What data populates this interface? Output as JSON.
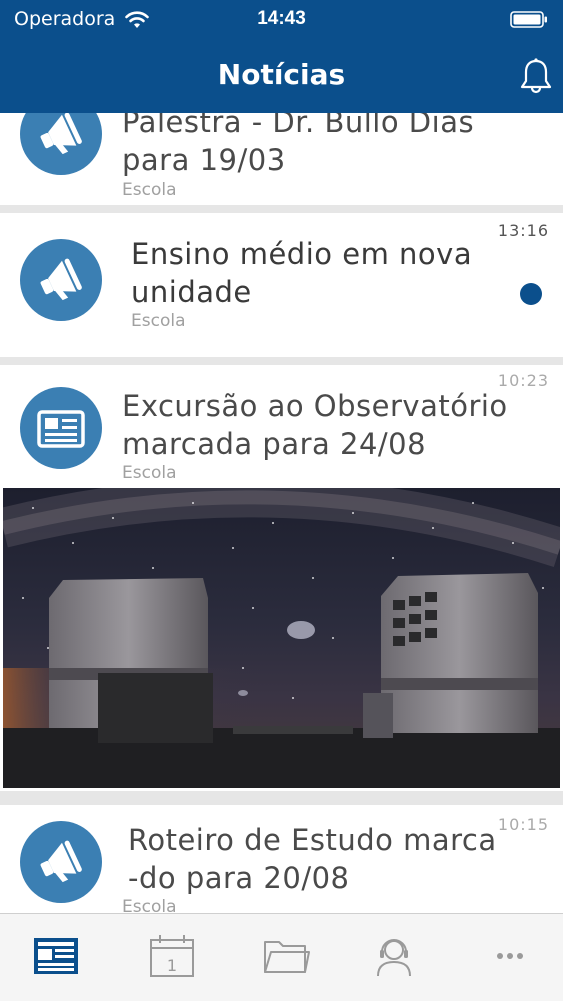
{
  "status_bar": {
    "carrier": "Operadora",
    "time": "14:43"
  },
  "header": {
    "title": "Notícias"
  },
  "news": [
    {
      "title_line1": "Palestra - Dr. Bullo Dias",
      "title_line2": "para 19/03",
      "source": "Escola",
      "time": "",
      "icon": "megaphone-icon"
    },
    {
      "title_line1": "Ensino médio em nova",
      "title_line2": "unidade",
      "source": "Escola",
      "time": "13:16",
      "unread": true,
      "icon": "megaphone-icon"
    },
    {
      "title_line1": "Excursão ao Observatório",
      "title_line2": "marcada para 24/08",
      "source": "Escola",
      "time": "10:23",
      "icon": "newspaper-icon",
      "has_photo": true
    },
    {
      "title_line1": "Roteiro de Estudo marca",
      "title_line2": "-do para 20/08",
      "source": "Escola",
      "time": "10:15",
      "icon": "megaphone-icon"
    }
  ],
  "tabbar": {
    "items": [
      {
        "icon": "news-icon",
        "active": true
      },
      {
        "icon": "calendar-icon",
        "calendar_day": "1",
        "active": false
      },
      {
        "icon": "folder-icon",
        "active": false
      },
      {
        "icon": "support-headset-icon",
        "active": false
      },
      {
        "icon": "more-icon",
        "active": false
      }
    ]
  },
  "colors": {
    "primary": "#0b4f8c",
    "icon_circle": "#3b7fb3",
    "separator": "#e6e6e6"
  }
}
